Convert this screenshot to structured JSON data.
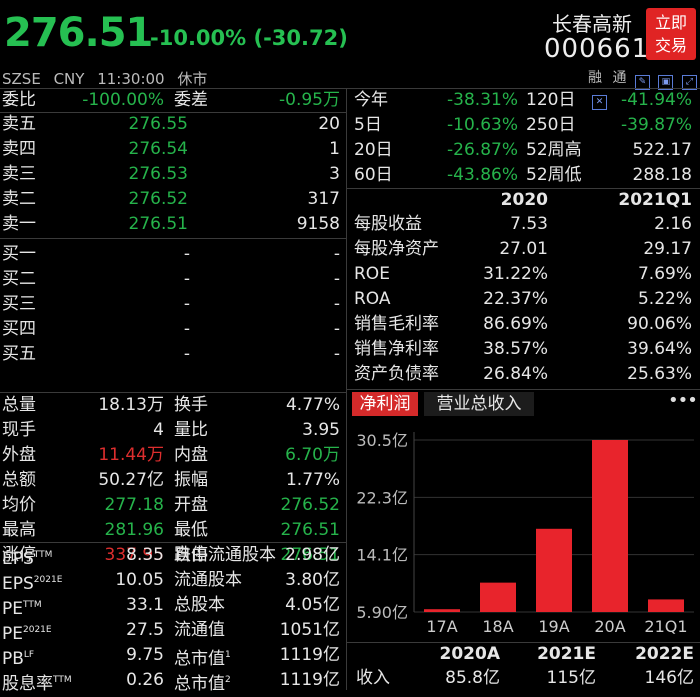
{
  "header": {
    "price": "276.51",
    "change": "-10.00% (-30.72)",
    "name": "长春高新",
    "code": "000661",
    "trade_button": [
      "立即",
      "交易"
    ],
    "exchange": "SZSE",
    "currency": "CNY",
    "time": "11:30:00",
    "status": "休市",
    "tool_label_margin": "融",
    "tool_label_connect": "通"
  },
  "stats_top": [
    {
      "label": "委比",
      "value": "-100.00%",
      "label2": "委差",
      "value2": "-0.95万"
    }
  ],
  "asks": [
    {
      "label": "卖五",
      "price": "276.55",
      "vol": "20"
    },
    {
      "label": "卖四",
      "price": "276.54",
      "vol": "1"
    },
    {
      "label": "卖三",
      "price": "276.53",
      "vol": "3"
    },
    {
      "label": "卖二",
      "price": "276.52",
      "vol": "317"
    },
    {
      "label": "卖一",
      "price": "276.51",
      "vol": "9158"
    }
  ],
  "bids": [
    {
      "label": "买一",
      "price": "-",
      "vol": "-"
    },
    {
      "label": "买二",
      "price": "-",
      "vol": "-"
    },
    {
      "label": "买三",
      "price": "-",
      "vol": "-"
    },
    {
      "label": "买四",
      "price": "-",
      "vol": "-"
    },
    {
      "label": "买五",
      "price": "-",
      "vol": "-"
    }
  ],
  "quote": [
    {
      "l1": "总量",
      "v1": "18.13万",
      "l2": "换手",
      "v2": "4.77%"
    },
    {
      "l1": "现手",
      "v1": "4",
      "l2": "量比",
      "v2": "3.95"
    },
    {
      "l1": "外盘",
      "v1": "11.44万",
      "l2": "内盘",
      "v2": "6.70万"
    },
    {
      "l1": "总额",
      "v1": "50.27亿",
      "l2": "振幅",
      "v2": "1.77%"
    },
    {
      "l1": "均价",
      "v1": "277.18",
      "l2": "开盘",
      "v2": "276.52"
    },
    {
      "l1": "最高",
      "v1": "281.96",
      "l2": "最低",
      "v2": "276.51"
    },
    {
      "l1": "涨停",
      "v1": "337.95",
      "l2": "跌停",
      "v2": "276.51"
    }
  ],
  "fundamentals": [
    {
      "l1": "EPS",
      "s1": "TTM",
      "v1": "8.35",
      "l2": "自由流通股本",
      "v2": "2.98亿"
    },
    {
      "l1": "EPS",
      "s1": "2021E",
      "v1": "10.05",
      "l2": "流通股本",
      "v2": "3.80亿"
    },
    {
      "l1": "PE",
      "s1": "TTM",
      "v1": "33.1",
      "l2": "总股本",
      "v2": "4.05亿"
    },
    {
      "l1": "PE",
      "s1": "2021E",
      "v1": "27.5",
      "l2": "流通值",
      "v2": "1051亿"
    },
    {
      "l1": "PB",
      "s1": "LF",
      "v1": "9.75",
      "l2": "总市值",
      "s2": "1",
      "v2": "1119亿"
    },
    {
      "l1": "股息率",
      "s1": "TTM",
      "v1": "0.26",
      "l2": "总市值",
      "s2": "2",
      "v2": "1119亿"
    }
  ],
  "periods": [
    {
      "l1": "今年",
      "v1": "-38.31%",
      "l2": "120日",
      "v2": "-41.94%"
    },
    {
      "l1": "5日",
      "v1": "-10.63%",
      "l2": "250日",
      "v2": "-39.87%"
    },
    {
      "l1": "20日",
      "v1": "-26.87%",
      "l2": "52周高",
      "v2": "522.17"
    },
    {
      "l1": "60日",
      "v1": "-43.86%",
      "l2": "52周低",
      "v2": "288.18"
    }
  ],
  "finance": {
    "headers": [
      "2020",
      "2021Q1"
    ],
    "rows": [
      {
        "label": "每股收益",
        "a": "7.53",
        "b": "2.16"
      },
      {
        "label": "每股净资产",
        "a": "27.01",
        "b": "29.17"
      },
      {
        "label": "ROE",
        "a": "31.22%",
        "b": "7.69%"
      },
      {
        "label": "ROA",
        "a": "22.37%",
        "b": "5.22%"
      },
      {
        "label": "销售毛利率",
        "a": "86.69%",
        "b": "90.06%"
      },
      {
        "label": "销售净利率",
        "a": "38.57%",
        "b": "39.64%"
      },
      {
        "label": "资产负债率",
        "a": "26.84%",
        "b": "25.63%"
      }
    ]
  },
  "tabs": {
    "active": "净利润",
    "other": "营业总收入"
  },
  "chart_data": {
    "type": "bar",
    "categories": [
      "17A",
      "18A",
      "19A",
      "20A",
      "21Q1"
    ],
    "values": [
      6.3,
      10.1,
      17.8,
      30.5,
      7.7
    ],
    "ytick_labels": [
      "30.5亿",
      "22.3亿",
      "14.1亿",
      "5.90亿"
    ],
    "ytick_values": [
      30.5,
      22.3,
      14.1,
      5.9
    ],
    "ylim": [
      5.9,
      30.5
    ],
    "bar_color": "#e8242c"
  },
  "forecast": {
    "years": [
      "2020A",
      "2021E",
      "2022E"
    ],
    "label": "收入",
    "values": [
      "85.8亿",
      "115亿",
      "146亿"
    ]
  },
  "colors": {
    "up": "#dd2e2e",
    "down": "#26b34b",
    "background": "#000000",
    "accent": "#d42a2a"
  }
}
